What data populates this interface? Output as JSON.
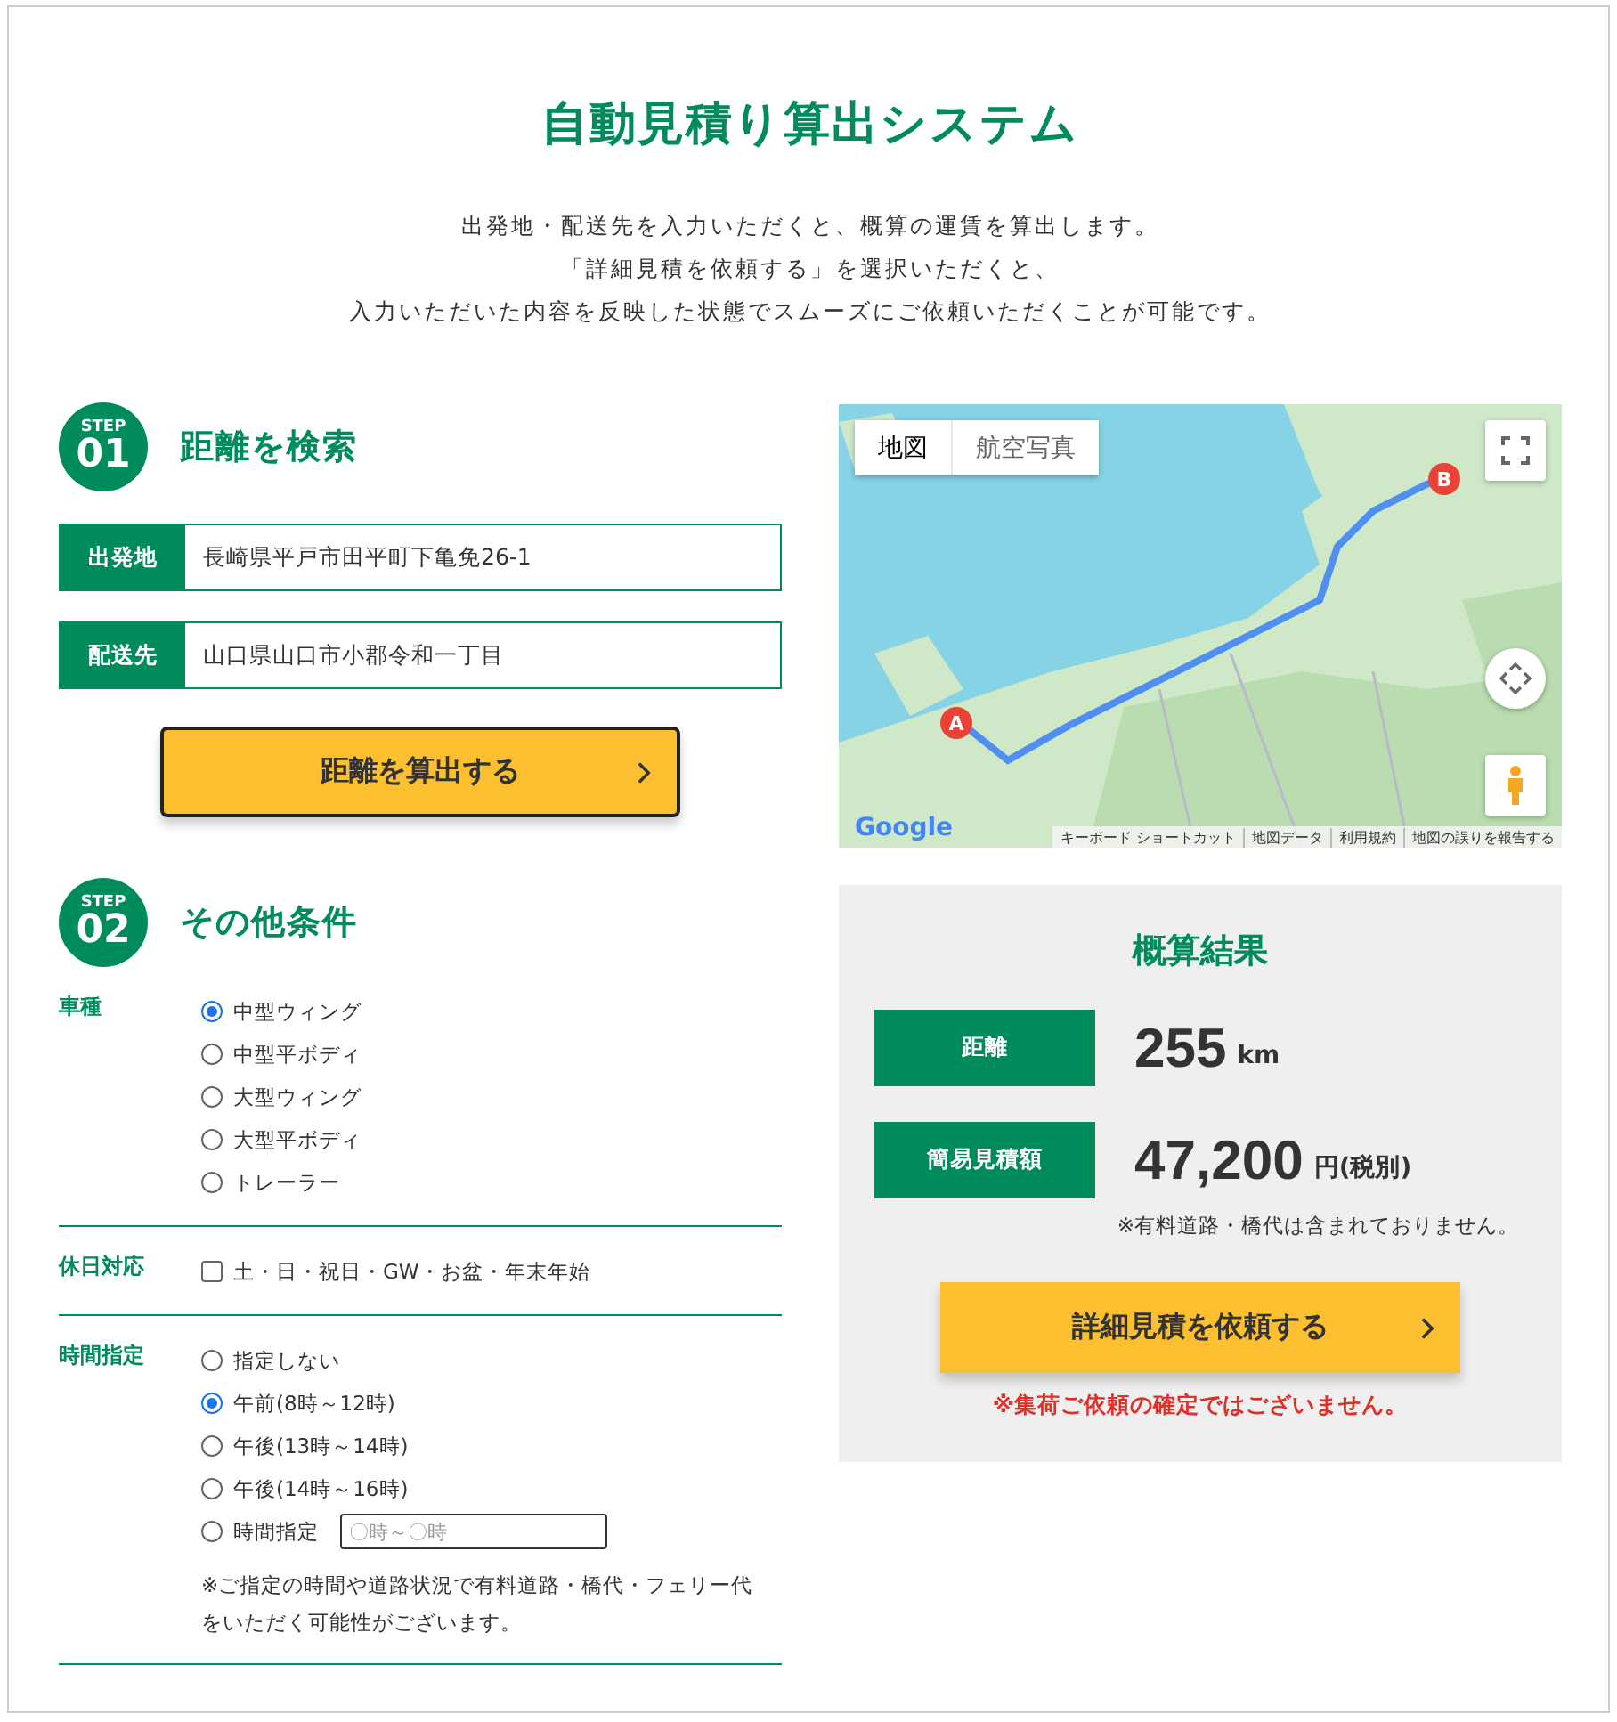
{
  "title": "自動見積り算出システム",
  "intro": [
    "出発地・配送先を入力いただくと、概算の運賃を算出します。",
    "「詳細見積を依頼する」を選択いただくと、",
    "入力いただいた内容を反映した状態でスムーズにご依頼いただくことが可能です。"
  ],
  "step1": {
    "badge_label": "STEP",
    "badge_number": "01",
    "heading": "距離を検索",
    "fields": [
      {
        "label": "出発地",
        "value": "長崎県平戸市田平町下亀免26-1"
      },
      {
        "label": "配送先",
        "value": "山口県山口市小郡令和一丁目"
      }
    ],
    "button": "距離を算出する"
  },
  "map": {
    "kind": "picture",
    "tabs": [
      {
        "label": "地図",
        "selected": true
      },
      {
        "label": "航空写真",
        "selected": false
      }
    ],
    "markers": [
      "A",
      "B"
    ],
    "logo": "Google",
    "footer_links": [
      "キーボード ショートカット",
      "地図データ",
      "利用規約",
      "地図の誤りを報告する"
    ]
  },
  "step2": {
    "badge_label": "STEP",
    "badge_number": "02",
    "heading": "その他条件",
    "groups": [
      {
        "label": "車種",
        "kind": "radio",
        "options": [
          {
            "label": "中型ウィング",
            "selected": true
          },
          {
            "label": "中型平ボディ",
            "selected": false
          },
          {
            "label": "大型ウィング",
            "selected": false
          },
          {
            "label": "大型平ボディ",
            "selected": false
          },
          {
            "label": "トレーラー",
            "selected": false
          }
        ]
      },
      {
        "label": "休日対応",
        "kind": "checkbox",
        "options": [
          {
            "label": "土・日・祝日・GW・お盆・年末年始",
            "checked": false
          }
        ]
      },
      {
        "label": "時間指定",
        "kind": "radio",
        "options": [
          {
            "label": "指定しない",
            "selected": false
          },
          {
            "label": "午前(8時～12時)",
            "selected": true
          },
          {
            "label": "午後(13時～14時)",
            "selected": false
          },
          {
            "label": "午後(14時～16時)",
            "selected": false
          },
          {
            "label": "時間指定",
            "selected": false,
            "placeholder": "〇時～〇時"
          }
        ],
        "note": "※ご指定の時間や道路状況で有料道路・橋代・フェリー代をいただく可能性がございます。"
      }
    ]
  },
  "result": {
    "heading": "概算結果",
    "rows": [
      {
        "label": "距離",
        "value": "255",
        "unit": "km"
      },
      {
        "label": "簡易見積額",
        "value": "47,200",
        "unit": "円(税別)"
      }
    ],
    "note": "※有料道路・橋代は含まれておりません。",
    "button": "詳細見積を依頼する",
    "warning": "※集荷ご依頼の確定ではございません。"
  }
}
